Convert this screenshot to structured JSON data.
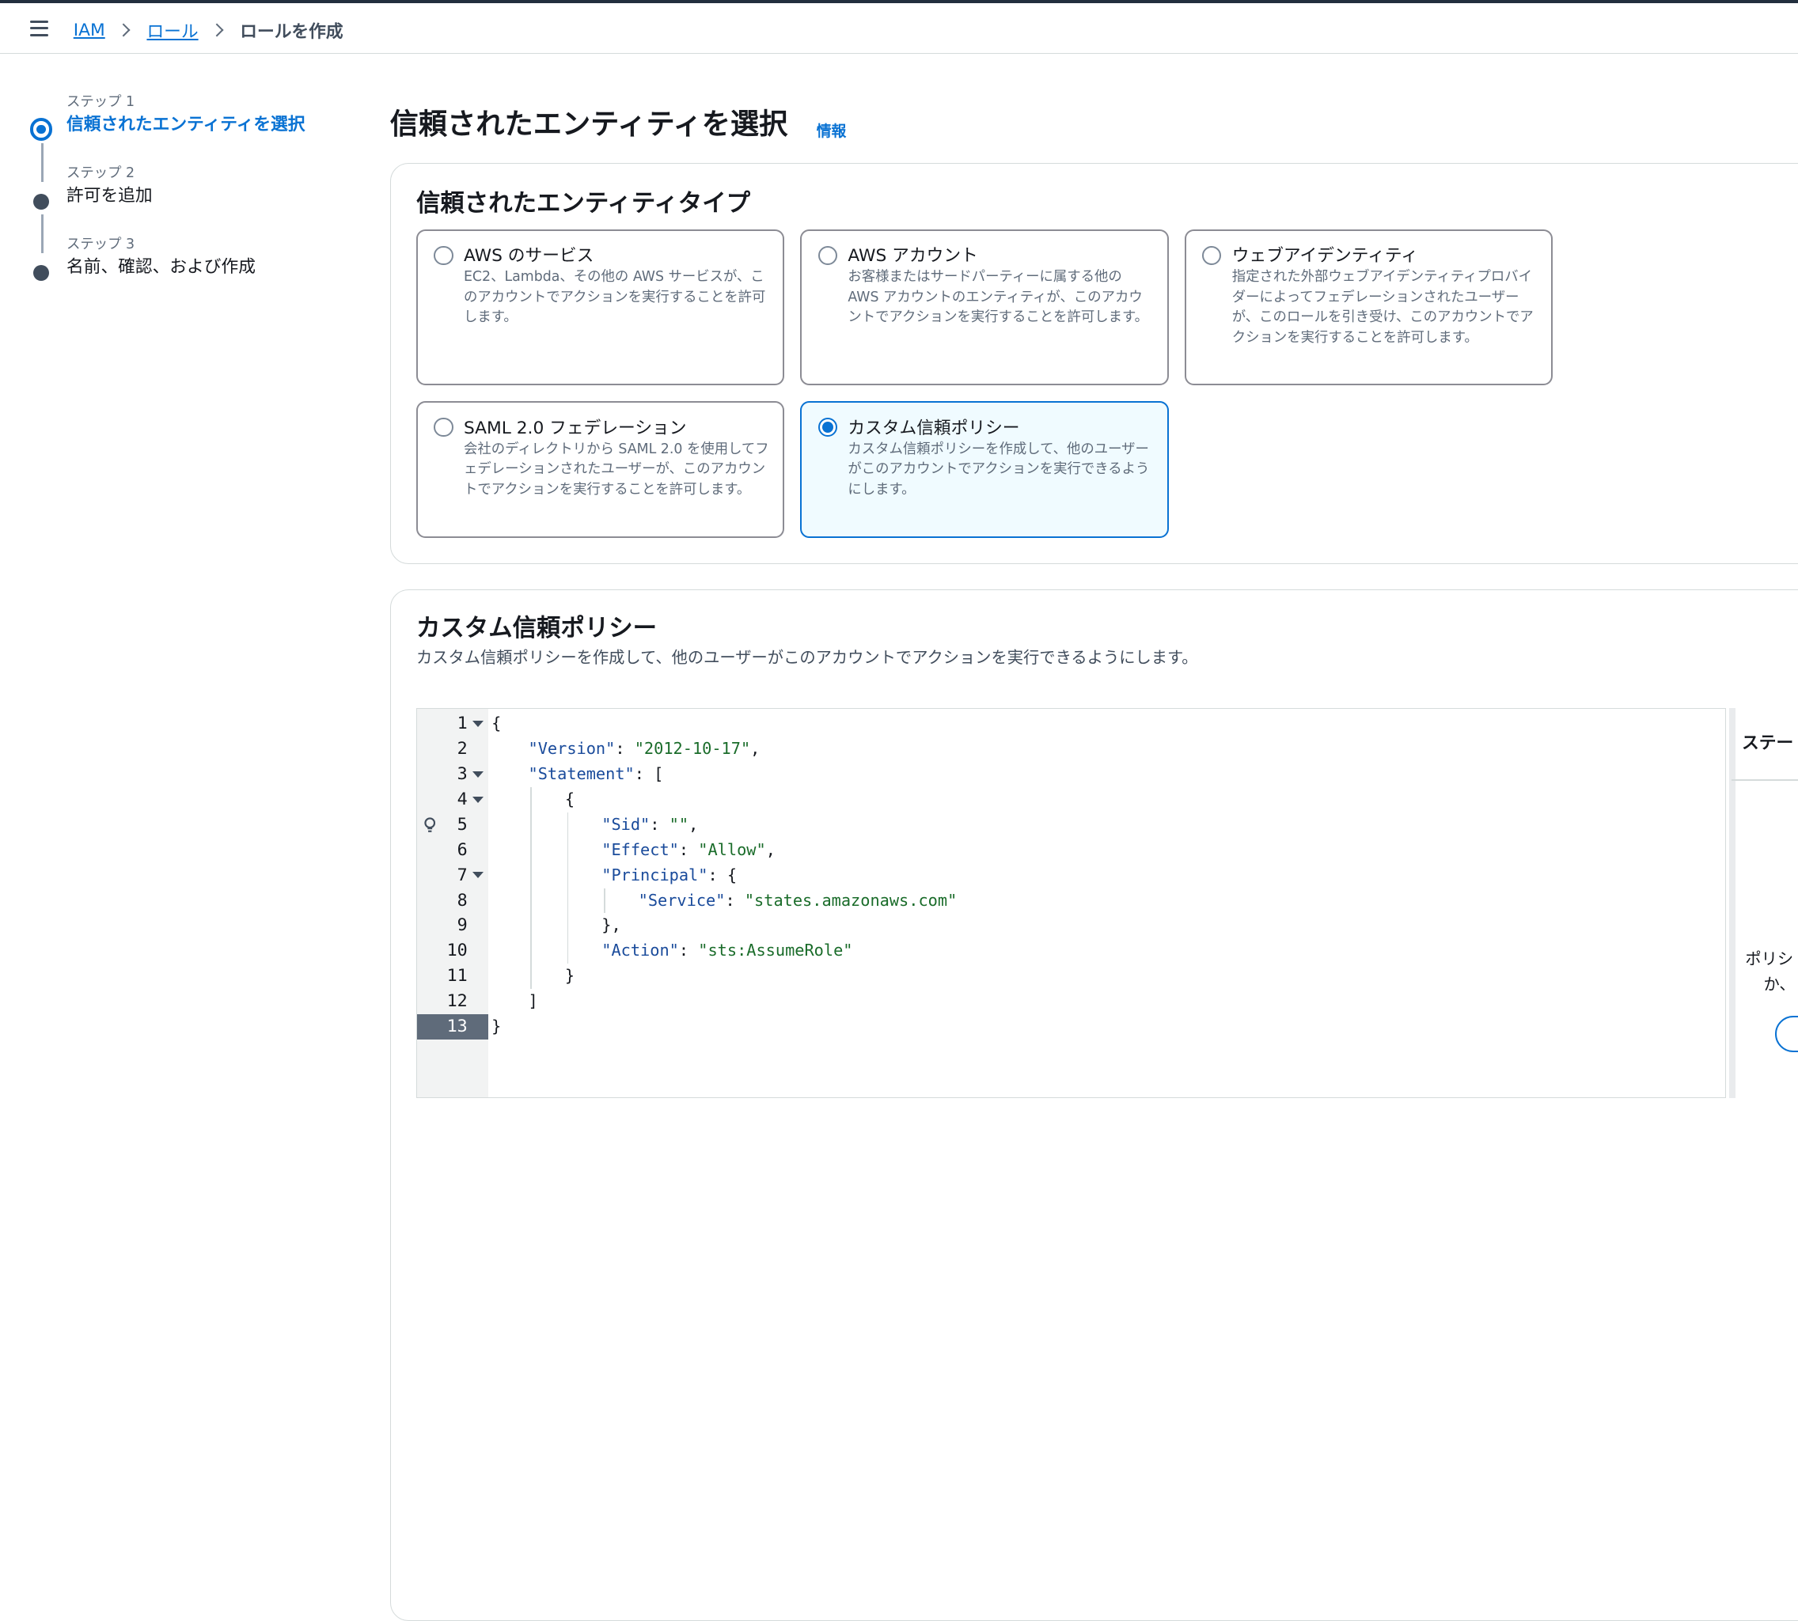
{
  "breadcrumb": {
    "items": [
      "IAM",
      "ロール"
    ],
    "current": "ロールを作成"
  },
  "steps": [
    {
      "label": "ステップ 1",
      "title": "信頼されたエンティティを選択",
      "active": true
    },
    {
      "label": "ステップ 2",
      "title": "許可を追加",
      "active": false
    },
    {
      "label": "ステップ 3",
      "title": "名前、確認、および作成",
      "active": false
    }
  ],
  "page": {
    "title": "信頼されたエンティティを選択",
    "info_link": "情報"
  },
  "entity_type": {
    "heading": "信頼されたエンティティタイプ",
    "options": [
      {
        "title": "AWS のサービス",
        "description": "EC2、Lambda、その他の AWS サービスが、このアカウントでアクションを実行することを許可します。",
        "selected": false
      },
      {
        "title": "AWS アカウント",
        "description": "お客様またはサードパーティーに属する他の AWS アカウントのエンティティが、このアカウントでアクションを実行することを許可します。",
        "selected": false
      },
      {
        "title": "ウェブアイデンティティ",
        "description": "指定された外部ウェブアイデンティティプロバイダーによってフェデレーションされたユーザーが、このロールを引き受け、このアカウントでアクションを実行することを許可します。",
        "selected": false
      },
      {
        "title": "SAML 2.0 フェデレーション",
        "description": "会社のディレクトリから SAML 2.0 を使用してフェデレーションされたユーザーが、このアカウントでアクションを実行することを許可します。",
        "selected": false
      },
      {
        "title": "カスタム信頼ポリシー",
        "description": "カスタム信頼ポリシーを作成して、他のユーザーがこのアカウントでアクションを実行できるようにします。",
        "selected": true
      }
    ]
  },
  "custom_policy": {
    "heading": "カスタム信頼ポリシー",
    "description": "カスタム信頼ポリシーを作成して、他のユーザーがこのアカウントでアクションを実行できるようにします。",
    "active_line": 13,
    "code_lines": [
      {
        "n": 1,
        "fold": true,
        "indent": 0,
        "tokens": [
          [
            "punc",
            "{"
          ]
        ]
      },
      {
        "n": 2,
        "fold": false,
        "indent": 1,
        "tokens": [
          [
            "key",
            "\"Version\""
          ],
          [
            "punc",
            ": "
          ],
          [
            "str",
            "\"2012-10-17\""
          ],
          [
            "punc",
            ","
          ]
        ]
      },
      {
        "n": 3,
        "fold": true,
        "indent": 1,
        "tokens": [
          [
            "key",
            "\"Statement\""
          ],
          [
            "punc",
            ": ["
          ]
        ]
      },
      {
        "n": 4,
        "fold": true,
        "indent": 2,
        "tokens": [
          [
            "punc",
            "{"
          ]
        ]
      },
      {
        "n": 5,
        "fold": false,
        "bulb": true,
        "indent": 3,
        "tokens": [
          [
            "key",
            "\"Sid\""
          ],
          [
            "punc",
            ": "
          ],
          [
            "str",
            "\"\""
          ],
          [
            "punc",
            ","
          ]
        ]
      },
      {
        "n": 6,
        "fold": false,
        "indent": 3,
        "tokens": [
          [
            "key",
            "\"Effect\""
          ],
          [
            "punc",
            ": "
          ],
          [
            "str",
            "\"Allow\""
          ],
          [
            "punc",
            ","
          ]
        ]
      },
      {
        "n": 7,
        "fold": true,
        "indent": 3,
        "tokens": [
          [
            "key",
            "\"Principal\""
          ],
          [
            "punc",
            ": {"
          ]
        ]
      },
      {
        "n": 8,
        "fold": false,
        "indent": 4,
        "tokens": [
          [
            "key",
            "\"Service\""
          ],
          [
            "punc",
            ": "
          ],
          [
            "str",
            "\"states.amazonaws.com\""
          ]
        ]
      },
      {
        "n": 9,
        "fold": false,
        "indent": 3,
        "tokens": [
          [
            "punc",
            "},"
          ]
        ]
      },
      {
        "n": 10,
        "fold": false,
        "indent": 3,
        "tokens": [
          [
            "key",
            "\"Action\""
          ],
          [
            "punc",
            ": "
          ],
          [
            "str",
            "\"sts:AssumeRole\""
          ]
        ]
      },
      {
        "n": 11,
        "fold": false,
        "indent": 2,
        "tokens": [
          [
            "punc",
            "}"
          ]
        ]
      },
      {
        "n": 12,
        "fold": false,
        "indent": 1,
        "tokens": [
          [
            "punc",
            "]"
          ]
        ]
      },
      {
        "n": 13,
        "fold": false,
        "indent": 0,
        "tokens": [
          [
            "punc",
            "}"
          ]
        ]
      }
    ]
  },
  "side_panel": {
    "heading": "ステー",
    "text_line1": "ポリシ",
    "text_line2": "か、"
  },
  "icons": {
    "menu": "hamburger-menu-icon",
    "breadcrumb_separator": "chevron-right-icon",
    "fold": "caret-down-icon",
    "hint": "lightbulb-icon"
  },
  "colors": {
    "accent": "#0972d3",
    "text": "#16191f",
    "muted": "#5f6b7a",
    "selected_bg": "#f0fbff"
  }
}
